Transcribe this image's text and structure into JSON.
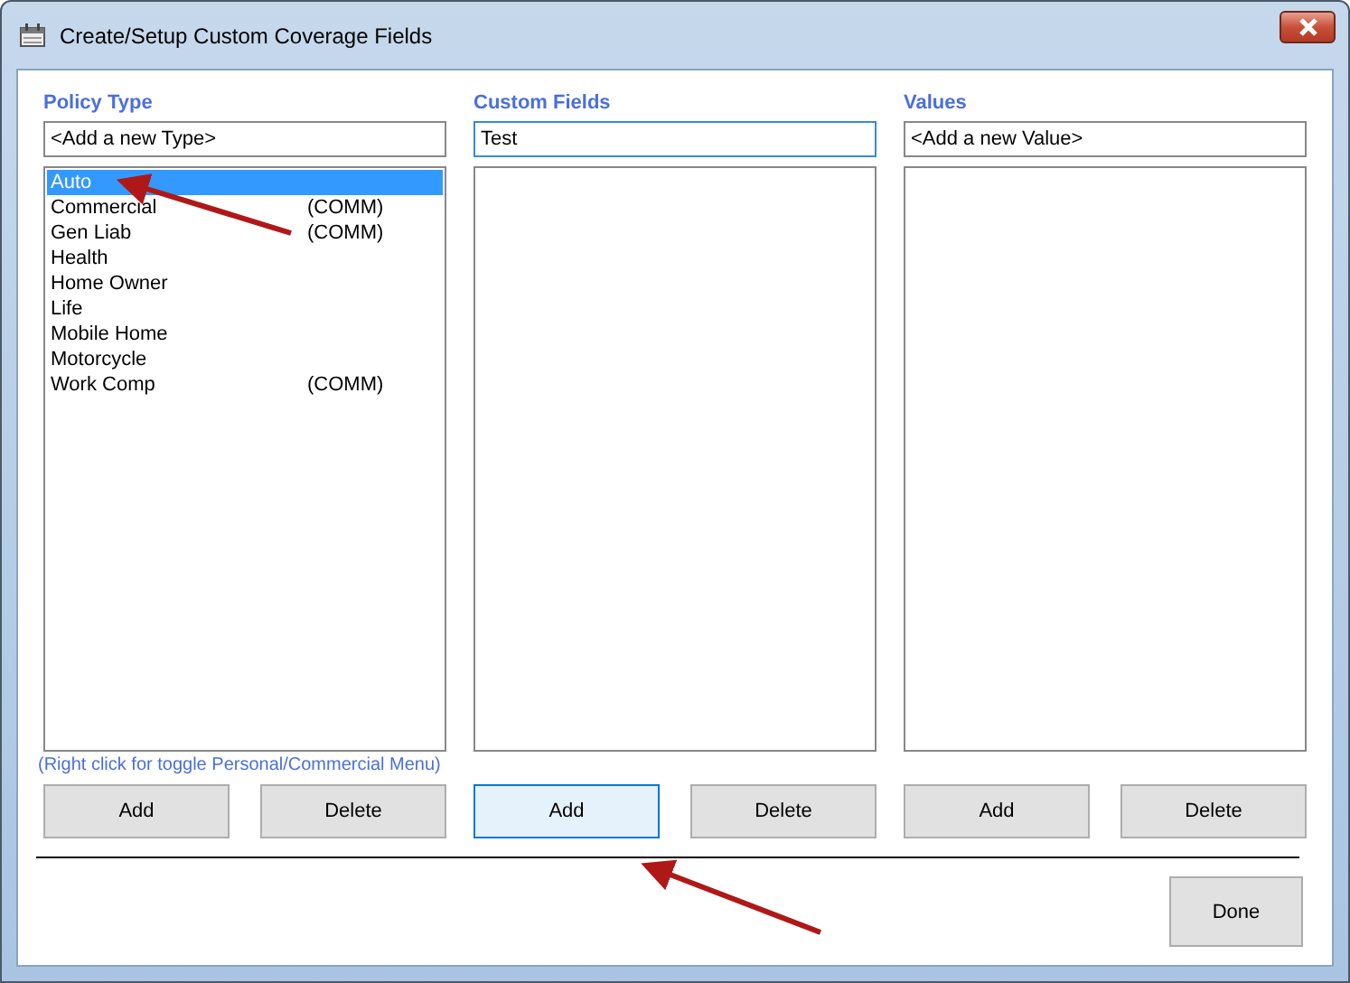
{
  "window": {
    "title": "Create/Setup Custom Coverage Fields"
  },
  "columns": [
    {
      "heading": "Policy Type",
      "input": {
        "value": "<Add a new Type>"
      },
      "items": [
        {
          "label": "Auto",
          "selected": true
        },
        {
          "label": "Commercial",
          "tag": "(COMM)",
          "selected": false
        },
        {
          "label": "Gen Liab",
          "tag": "(COMM)",
          "selected": false
        },
        {
          "label": "Health",
          "selected": false
        },
        {
          "label": "Home Owner",
          "selected": false
        },
        {
          "label": "Life",
          "selected": false
        },
        {
          "label": "Mobile Home",
          "selected": false
        },
        {
          "label": "Motorcycle",
          "selected": false
        },
        {
          "label": "Work Comp",
          "tag": "(COMM)",
          "selected": false
        }
      ],
      "hint": "(Right click for toggle Personal/Commercial Menu)",
      "buttons": [
        {
          "label": "Add",
          "focused": false
        },
        {
          "label": "Delete",
          "focused": false
        }
      ]
    },
    {
      "heading": "Custom Fields",
      "input": {
        "value": "Test",
        "focused": true
      },
      "buttons": [
        {
          "label": "Add",
          "focused": true
        },
        {
          "label": "Delete",
          "focused": false
        }
      ]
    },
    {
      "heading": "Values",
      "input": {
        "value": "<Add a new Value>"
      },
      "buttons": [
        {
          "label": "Add",
          "focused": false
        },
        {
          "label": "Delete",
          "focused": false
        }
      ]
    }
  ],
  "done_button": {
    "label": "Done"
  }
}
